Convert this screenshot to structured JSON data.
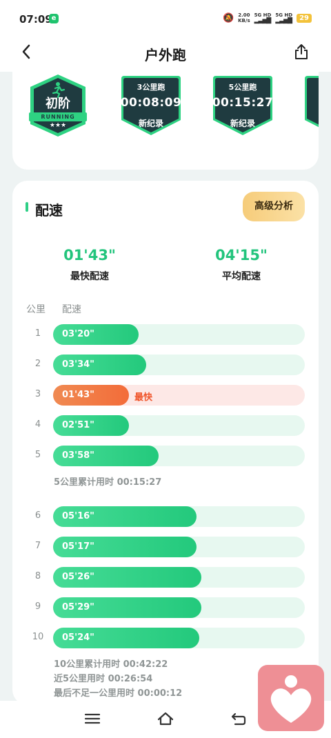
{
  "status_bar": {
    "time": "07:09",
    "speed": "2.00",
    "speed_unit": "KB/s",
    "sim1": "5G HD",
    "sim2": "5G HD",
    "battery": "29"
  },
  "header": {
    "title": "户外跑"
  },
  "badges": {
    "level_badge": {
      "title": "初阶",
      "subtitle": "RUNNING",
      "stars": "★★★"
    },
    "records": [
      {
        "title": "3公里跑",
        "time": "00:08:09",
        "tag": "新纪录"
      },
      {
        "title": "5公里跑",
        "time": "00:15:27",
        "tag": "新纪录"
      }
    ]
  },
  "pace": {
    "title": "配速",
    "advanced_button": "高级分析",
    "fastest_value": "01'43\"",
    "fastest_label": "最快配速",
    "average_value": "04'15\"",
    "average_label": "平均配速",
    "col_km": "公里",
    "col_pace": "配速",
    "fastest_tag": "最快",
    "splits": [
      {
        "km": "1",
        "pace": "03'20\"",
        "fill": 0.34
      },
      {
        "km": "2",
        "pace": "03'34\"",
        "fill": 0.37
      },
      {
        "km": "3",
        "pace": "01'43\"",
        "fill": 0.3,
        "fastest": true
      },
      {
        "km": "4",
        "pace": "02'51\"",
        "fill": 0.3
      },
      {
        "km": "5",
        "pace": "03'58\"",
        "fill": 0.42
      },
      {
        "km": "6",
        "pace": "05'16\"",
        "fill": 0.57
      },
      {
        "km": "7",
        "pace": "05'17\"",
        "fill": 0.57
      },
      {
        "km": "8",
        "pace": "05'26\"",
        "fill": 0.59
      },
      {
        "km": "9",
        "pace": "05'29\"",
        "fill": 0.59
      },
      {
        "km": "10",
        "pace": "05'24\"",
        "fill": 0.58
      }
    ],
    "summary_5km": "5公里累计用时 00:15:27",
    "summary_10km": "10公里累计用时 00:42:22",
    "summary_last5": "近5公里用时 00:26:54",
    "summary_remain": "最后不足一公里用时 00:00:12"
  },
  "colors": {
    "accent_green": "#23c97c",
    "fastest_orange": "#f36c39",
    "badge_dark": "#1f3b40"
  }
}
